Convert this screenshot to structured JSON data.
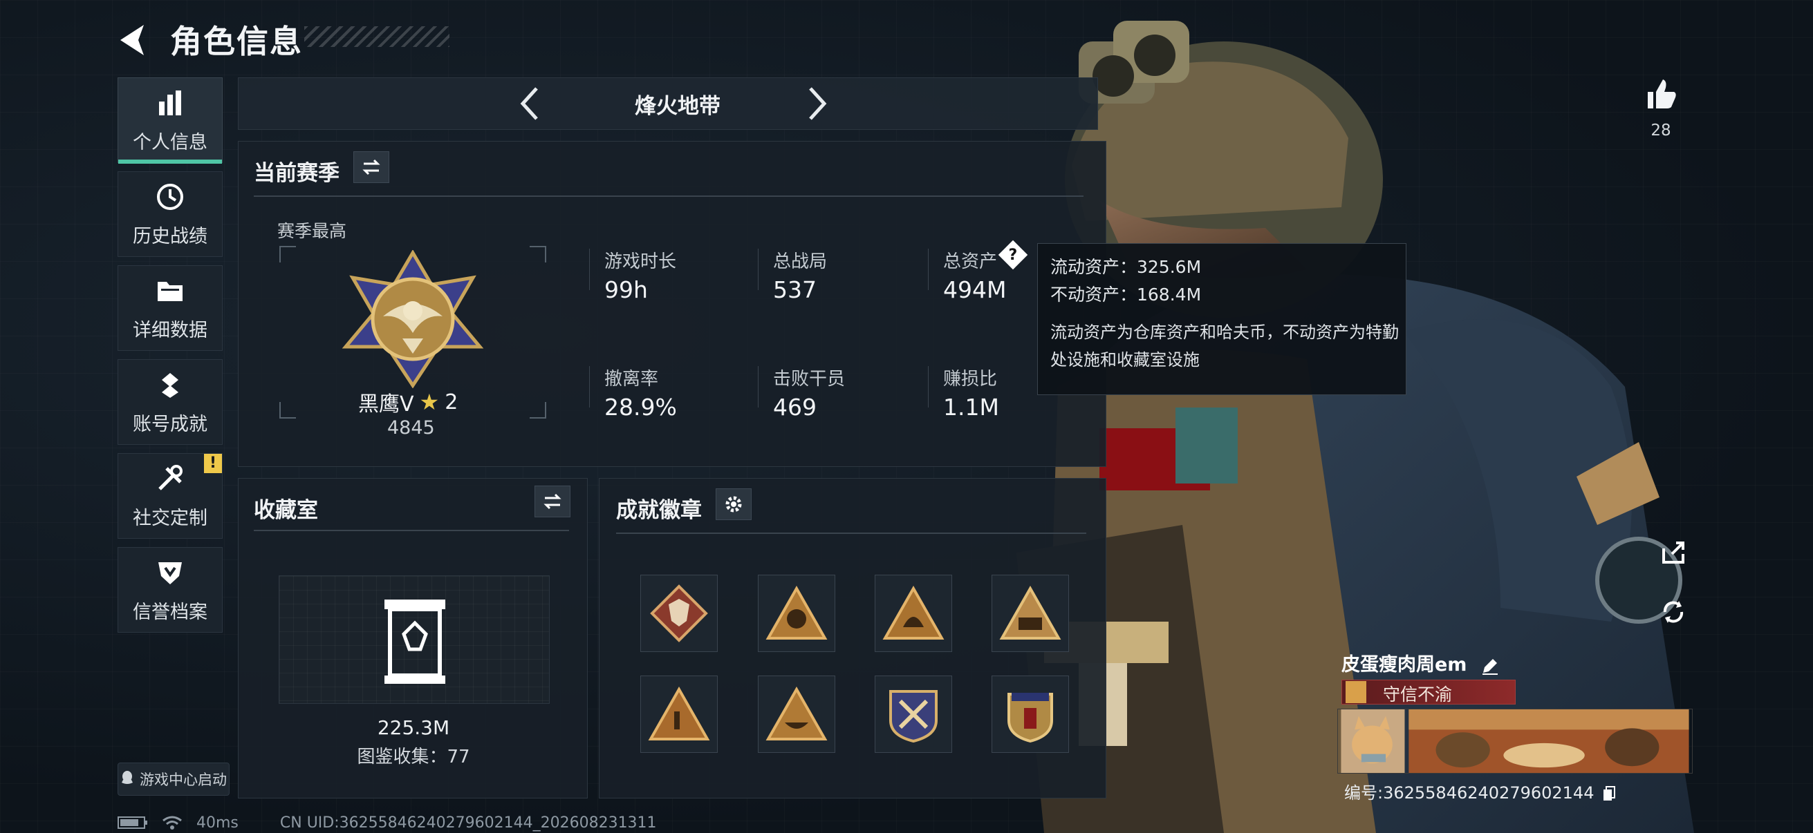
{
  "header": {
    "title": "角色信息"
  },
  "nav": {
    "items": [
      {
        "label": "个人信息",
        "icon": "bar-chart-icon",
        "active": true
      },
      {
        "label": "历史战绩",
        "icon": "clock-history-icon"
      },
      {
        "label": "详细数据",
        "icon": "folder-icon"
      },
      {
        "label": "账号成就",
        "icon": "achievement-medal-icon"
      },
      {
        "label": "社交定制",
        "icon": "tools-icon",
        "alert": "!"
      },
      {
        "label": "信誉档案",
        "icon": "shield-credit-icon"
      }
    ],
    "game_center": "游戏中心启动"
  },
  "mode": {
    "label": "烽火地带"
  },
  "season": {
    "title": "当前赛季",
    "best_label": "赛季最高",
    "rank_name": "黑鹰V",
    "rank_star": "★",
    "rank_stars": "2",
    "rank_points": "4845",
    "stats": [
      {
        "label": "游戏时长",
        "value": "99h"
      },
      {
        "label": "总战局",
        "value": "537"
      },
      {
        "label": "总资产",
        "value": "494M",
        "help": "?"
      },
      {
        "label": "撤离率",
        "value": "28.9%"
      },
      {
        "label": "击败干员",
        "value": "469"
      },
      {
        "label": "赚损比",
        "value": "1.1M"
      }
    ]
  },
  "tooltip": {
    "liquid": "流动资产：325.6M",
    "fixed": "不动资产：168.4M",
    "desc": "流动资产为仓库资产和哈夫币，不动资产为特勤处设施和收藏室设施"
  },
  "collection": {
    "title": "收藏室",
    "value": "225.3M",
    "count_text": "图鉴收集：77"
  },
  "badges": {
    "title": "成就徽章",
    "items": [
      "wolf-badge-icon",
      "rider-badge-icon",
      "crest-badge-icon",
      "squad-badge-icon",
      "hand-sign-badge-icon",
      "bowl-badge-icon",
      "crossed-arrows-badge-icon",
      "stars-shield-badge-icon"
    ]
  },
  "player": {
    "likes": "28",
    "name": "皮蛋瘦肉周em",
    "honor": "守信不渝",
    "uid": "编号:36255846240279602144"
  },
  "status": {
    "ping": "40ms",
    "footer_uid": "CN UID:36255846240279602144_202608231311"
  },
  "colors": {
    "accent": "#4fc6a6",
    "alert": "#f0c94a",
    "honor": "#8e2a2a"
  }
}
